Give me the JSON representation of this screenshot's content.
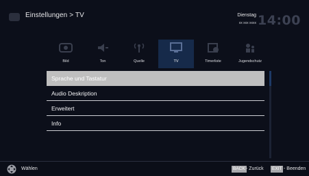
{
  "header": {
    "breadcrumb": "Einstellungen > TV",
    "day": "Dienstag",
    "date": "xx xxx xxxx",
    "time": "14:00"
  },
  "tabs": [
    {
      "label": "Bild",
      "icon": "picture-icon"
    },
    {
      "label": "Ton",
      "icon": "speaker-icon"
    },
    {
      "label": "Quelle",
      "icon": "antenna-icon"
    },
    {
      "label": "TV",
      "icon": "tv-icon",
      "active": true
    },
    {
      "label": "Timerliste",
      "icon": "timer-list-icon"
    },
    {
      "label": "Jugendschutz",
      "icon": "parental-icon"
    }
  ],
  "menu": {
    "items": [
      {
        "label": "Sprache und Tastatur",
        "selected": true
      },
      {
        "label": "Audio Deskription"
      },
      {
        "label": "Erweitert"
      },
      {
        "label": "Info"
      }
    ]
  },
  "footer": {
    "select_label": "Wählen",
    "back_key": "BACK",
    "back_label": "- Zurück",
    "exit_key": "EXIT",
    "exit_label": "- Beenden"
  },
  "colors": {
    "background": "#0c0f1a",
    "selected_item": "#bfbfbf",
    "active_tab": "#162a4a",
    "key_badge": "#a8a8ac"
  }
}
